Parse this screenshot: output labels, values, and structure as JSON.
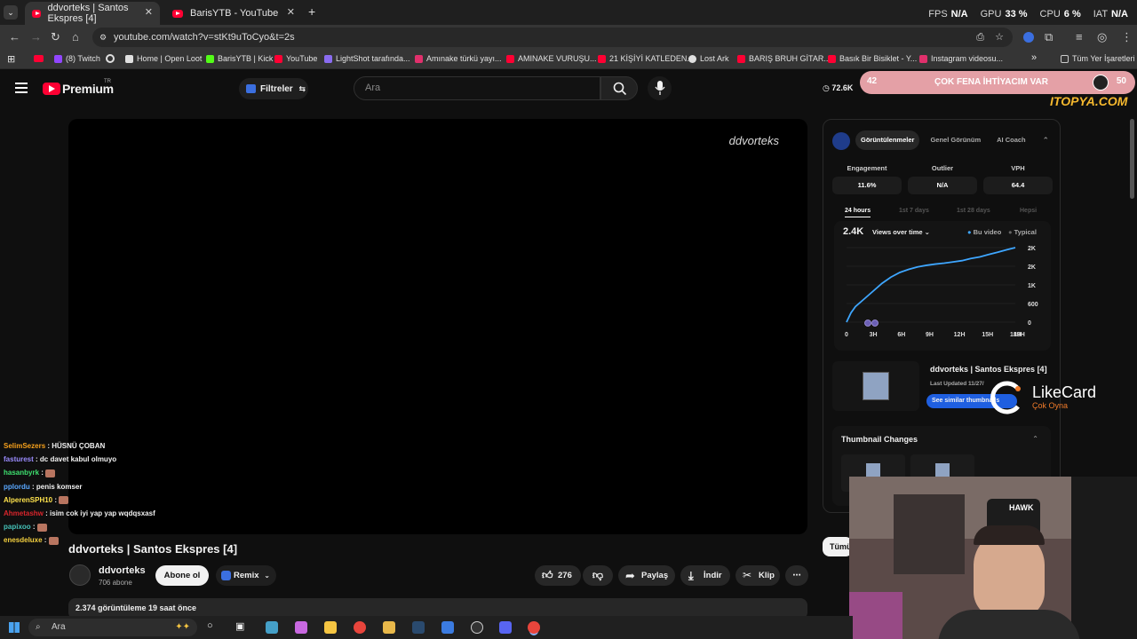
{
  "browser": {
    "tabs": [
      {
        "title": "ddvorteks | Santos Ekspres [4]",
        "active": true
      },
      {
        "title": "BarisYTB - YouTube",
        "active": false
      }
    ],
    "url": "youtube.com/watch?v=stKt9uToCyo&t=2s",
    "hud": {
      "fps_label": "FPS",
      "fps": "N/A",
      "gpu_label": "GPU",
      "gpu": "33 %",
      "cpu_label": "CPU",
      "cpu": "6 %",
      "bat_label": "ΙΑΤ",
      "bat": "N/A"
    }
  },
  "bookmarks": [
    {
      "label": "(8) Twitch",
      "color": "#9146ff"
    },
    {
      "label": "Home | Open Loot",
      "color": "#e0e0e0"
    },
    {
      "label": "BarisYTB | Kick",
      "color": "#53fc18"
    },
    {
      "label": "YouTube",
      "color": "#ff0033"
    },
    {
      "label": "LightShot tarafında...",
      "color": "#8a6cf0"
    },
    {
      "label": "Amınake türkü yayı...",
      "color": "#e1306c"
    },
    {
      "label": "AMINAKE VURUŞU...",
      "color": "#ff0033"
    },
    {
      "label": "21 KİŞİYİ KATLEDEN...",
      "color": "#ff0033"
    },
    {
      "label": "Lost Ark",
      "color": "#e0e0e0"
    },
    {
      "label": "BARIŞ BRUH GİTAR...",
      "color": "#ff0033"
    },
    {
      "label": "Basık Bir Bisiklet - Y...",
      "color": "#ff0033"
    },
    {
      "label": "Instagram videosu...",
      "color": "#e1306c"
    }
  ],
  "bookmarks_all": "Tüm Yer İşaretleri",
  "header": {
    "logo": "Premium",
    "logo_sup": "TR",
    "filters": "Filtreler",
    "search_placeholder": "Ara",
    "views_stat": "72.6K",
    "banner_left": "42",
    "banner_text": "ÇOK FENA İHTİYACIM VAR",
    "banner_right": "50",
    "brand": "ITOPYA.COM"
  },
  "video": {
    "watermark": "ddvorteks",
    "title": "ddvorteks | Santos Ekspres [4]",
    "channel": "ddvorteks",
    "subscribers": "706 abone",
    "subscribe": "Abone ol",
    "remix": "Remix",
    "likes": "276",
    "share": "Paylaş",
    "download": "İndir",
    "clip": "Klip",
    "description": "2.374 görüntüleme  19 saat önce"
  },
  "chat": [
    {
      "user": "SelimSezers",
      "color": "#f7a11c",
      "msg": "HÜSNÜ ÇOBAN",
      "emote": false
    },
    {
      "user": "fasturest",
      "color": "#9b8cff",
      "msg": "dc davet kabul olmuyo",
      "emote": false
    },
    {
      "user": "hasanbyrk",
      "color": "#3ee06f",
      "msg": "",
      "emote": true
    },
    {
      "user": "pplordu",
      "color": "#5aa8ff",
      "msg": "penis komser",
      "emote": false
    },
    {
      "user": "AlperenSPH10",
      "color": "#ffe34d",
      "msg": "",
      "emote": true
    },
    {
      "user": "Ahmetashw",
      "color": "#d8252c",
      "msg": "isim cok iyi yap yap wqdqsxasf",
      "emote": false
    },
    {
      "user": "papixoo",
      "color": "#45c2b8",
      "msg": "",
      "emote": true
    },
    {
      "user": "enesdeluxe",
      "color": "#f4d03f",
      "msg": "",
      "emote": true
    }
  ],
  "vidiq": {
    "tabs": [
      "Görüntülenmeler",
      "Genel Görünüm",
      "AI Coach"
    ],
    "metrics": [
      {
        "label": "Engagement",
        "value": "11.6%"
      },
      {
        "label": "Outlier",
        "value": "N/A"
      },
      {
        "label": "VPH",
        "value": "64.4"
      }
    ],
    "ranges": [
      "24 hours",
      "1st 7 days",
      "1st 28 days",
      "Hepsi"
    ],
    "total": "2.4K",
    "dropdown": "Views over time",
    "legend_this": "Bu video",
    "legend_typical": "Typical",
    "thumb_title": "ddvorteks | Santos Ekspres [4]",
    "thumb_updated": "Last Updated 11/27/",
    "thumb_btn": "See similar thumbnails",
    "thumb_changes": "Thumbnail Changes",
    "all_btn": "Tümü"
  },
  "likecard": {
    "title": "LikeCard",
    "sub": "Çok Oyna"
  },
  "taskbar": {
    "search": "Ara"
  },
  "chart_data": {
    "type": "line",
    "x_ticks": [
      "0",
      "3H",
      "6H",
      "9H",
      "12H",
      "15H",
      "18H",
      "19H"
    ],
    "y_ticks": [
      "2K",
      "2K",
      "1K",
      "600",
      "0"
    ],
    "x_hours": [
      0,
      0.5,
      1,
      2,
      3,
      4,
      5,
      6,
      7,
      8,
      9,
      10,
      11,
      12,
      13,
      14,
      15,
      16,
      17,
      18,
      19
    ],
    "series": [
      {
        "name": "Bu video",
        "color": "#3ea6ff",
        "values": [
          0,
          300,
          500,
          750,
          1000,
          1250,
          1450,
          1600,
          1700,
          1780,
          1830,
          1870,
          1900,
          1940,
          1980,
          2050,
          2100,
          2180,
          2250,
          2330,
          2400
        ]
      }
    ],
    "xlim": [
      0,
      19
    ],
    "ylim": [
      0,
      2400
    ]
  }
}
